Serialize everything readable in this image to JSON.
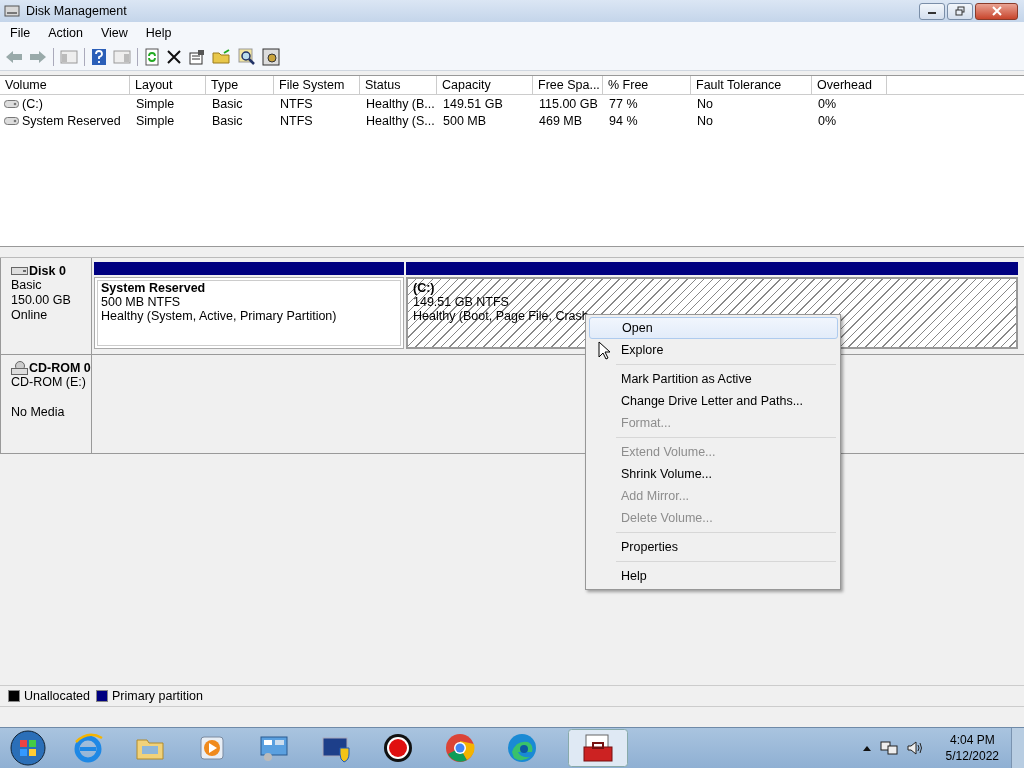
{
  "window": {
    "title": "Disk Management"
  },
  "menu": [
    {
      "label": "File"
    },
    {
      "label": "Action"
    },
    {
      "label": "View"
    },
    {
      "label": "Help"
    }
  ],
  "table": {
    "columns": [
      "Volume",
      "Layout",
      "Type",
      "File System",
      "Status",
      "Capacity",
      "Free Spa...",
      "% Free",
      "Fault Tolerance",
      "Overhead"
    ],
    "rows": [
      {
        "cells": [
          "(C:)",
          "Simple",
          "Basic",
          "NTFS",
          "Healthy (B...",
          "149.51 GB",
          "115.00 GB",
          "77 %",
          "No",
          "0%"
        ]
      },
      {
        "cells": [
          "System Reserved",
          "Simple",
          "Basic",
          "NTFS",
          "Healthy (S...",
          "500 MB",
          "469 MB",
          "94 %",
          "No",
          "0%"
        ]
      }
    ]
  },
  "disks": [
    {
      "kind": "disk",
      "name": "Disk 0",
      "lines": [
        "Basic",
        "150.00 GB",
        "Online"
      ],
      "partitions": [
        {
          "name": "System Reserved",
          "size": "500 MB NTFS",
          "status": "Healthy (System, Active, Primary Partition)",
          "selected": false
        },
        {
          "name": "(C:)",
          "size": "149.51 GB NTFS",
          "status": "Healthy (Boot, Page File, Crash",
          "selected": true
        }
      ]
    },
    {
      "kind": "cdrom",
      "name": "CD-ROM 0",
      "lines": [
        "CD-ROM (E:)",
        "No Media"
      ]
    }
  ],
  "legend": [
    {
      "label": "Unallocated",
      "color": "#000000"
    },
    {
      "label": "Primary partition",
      "color": "#000080"
    }
  ],
  "context_menu": {
    "groups": [
      [
        {
          "label": "Open",
          "disabled": false,
          "selected": true
        },
        {
          "label": "Explore",
          "disabled": false,
          "selected": false
        }
      ],
      [
        {
          "label": "Mark Partition as Active",
          "disabled": false,
          "selected": false
        },
        {
          "label": "Change Drive Letter and Paths...",
          "disabled": false,
          "selected": false
        },
        {
          "label": "Format...",
          "disabled": true,
          "selected": false
        }
      ],
      [
        {
          "label": "Extend Volume...",
          "disabled": true,
          "selected": false
        },
        {
          "label": "Shrink Volume...",
          "disabled": false,
          "selected": false
        },
        {
          "label": "Add Mirror...",
          "disabled": true,
          "selected": false
        },
        {
          "label": "Delete Volume...",
          "disabled": true,
          "selected": false
        }
      ],
      [
        {
          "label": "Properties",
          "disabled": false,
          "selected": false
        }
      ],
      [
        {
          "label": "Help",
          "disabled": false,
          "selected": false
        }
      ]
    ]
  },
  "taskbar": {
    "time": "4:04 PM",
    "date": "5/12/2022"
  }
}
